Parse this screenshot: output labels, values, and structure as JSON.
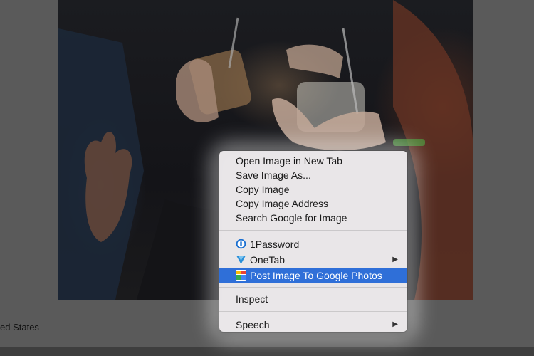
{
  "page": {
    "footer_text": "ed States"
  },
  "context_menu": {
    "groups": [
      {
        "items": [
          {
            "label": "Open Image in New Tab"
          },
          {
            "label": "Save Image As..."
          },
          {
            "label": "Copy Image"
          },
          {
            "label": "Copy Image Address"
          },
          {
            "label": "Search Google for Image"
          }
        ]
      },
      {
        "items": [
          {
            "label": "1Password",
            "icon": "1password-icon"
          },
          {
            "label": "OneTab",
            "icon": "onetab-icon",
            "submenu": true
          },
          {
            "label": "Post Image To Google Photos",
            "icon": "google-photos-icon",
            "selected": true
          }
        ]
      },
      {
        "items": [
          {
            "label": "Inspect"
          }
        ]
      },
      {
        "items": [
          {
            "label": "Speech",
            "submenu": true
          }
        ]
      }
    ],
    "submenu_arrow": "▶",
    "selected_color": "#2f6fd8"
  }
}
